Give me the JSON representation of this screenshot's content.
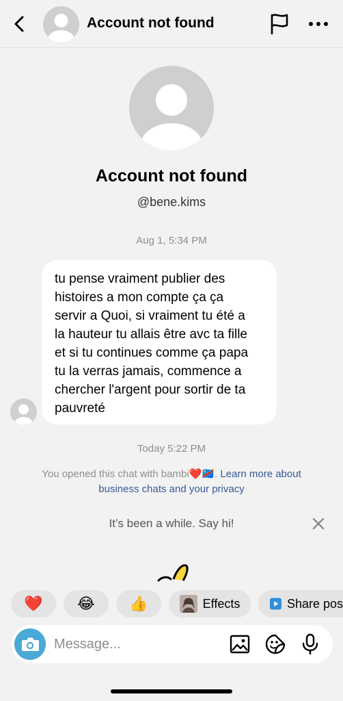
{
  "header": {
    "title": "Account not found"
  },
  "profile": {
    "name": "Account not found",
    "handle": "@bene.kims"
  },
  "thread": {
    "first_timestamp": "Aug 1, 5:34 PM",
    "message": "tu pense vraiment publier des\nhistoires a mon compte ça ça\nservir a Quoi, si vraiment tu été a\nla hauteur tu allais être avc ta fille\net si tu continues comme ça papa\ntu la verras jamais, commence a\nchercher l'argent pour sortir de ta\npauvreté",
    "second_timestamp": "Today 5:22 PM",
    "info_prefix": "You opened this chat with bambi❤️🇨🇩.",
    "info_link": "Learn more about business chats and your privacy",
    "say_hi": "It’s been a while. Say hi!"
  },
  "quick_replies": [
    {
      "emoji": "❤️"
    },
    {
      "emoji": "😂"
    },
    {
      "emoji": "👍"
    },
    {
      "label": "Effects"
    },
    {
      "label": "Share pos"
    }
  ],
  "composer": {
    "placeholder": "Message..."
  },
  "icons": {
    "header": [
      "chevron-left-icon",
      "avatar-placeholder",
      "flag-icon",
      "more-icon"
    ],
    "composer": [
      "camera-icon",
      "gallery-icon",
      "sticker-icon",
      "microphone-icon"
    ]
  },
  "colors": {
    "background": "#f2f2f2",
    "bubble": "#ffffff",
    "link": "#385898",
    "camera_button": "#4aa9d6",
    "chip": "#e4e4e4",
    "muted_text": "#8e8e8e"
  }
}
